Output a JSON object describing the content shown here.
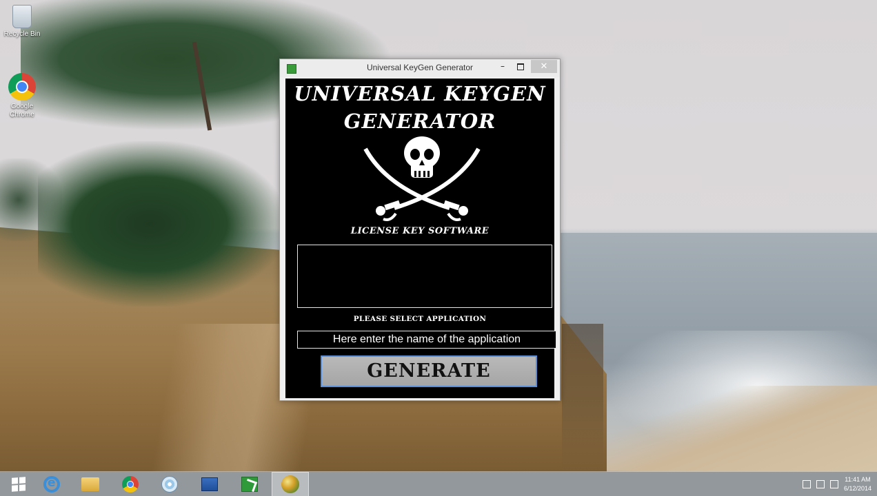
{
  "desktop": {
    "icons": [
      {
        "label": "Recycle Bin",
        "icon": "recycle-bin-icon"
      },
      {
        "label": "Google Chrome",
        "icon": "chrome-icon"
      }
    ]
  },
  "window": {
    "title": "Universal KeyGen Generator",
    "controls": {
      "minimize": "–",
      "close": "✕"
    },
    "heading_line1": "UNIVERSAL KEYGEN",
    "heading_line2": "GENERATOR",
    "logo_icon": "skull-crossed-swords-icon",
    "logo_caption": "LICENSE KEY SOFTWARE",
    "output_text": "",
    "select_label": "PLEASE SELECT APPLICATION",
    "app_input": {
      "value": "",
      "placeholder": "Here enter the name of the application"
    },
    "generate_label": "GENERATE",
    "accent_color": "#5a8ed6"
  },
  "taskbar": {
    "items": [
      {
        "name": "start-button",
        "icon": "windows-logo-icon"
      },
      {
        "name": "internet-explorer",
        "icon": "internet-explorer-icon"
      },
      {
        "name": "file-explorer",
        "icon": "folder-icon"
      },
      {
        "name": "google-chrome",
        "icon": "chrome-icon"
      },
      {
        "name": "media-disc",
        "icon": "disc-icon"
      },
      {
        "name": "network-app",
        "icon": "network-icon"
      },
      {
        "name": "keygen-app",
        "icon": "keygen-icon"
      },
      {
        "name": "active-app",
        "icon": "orb-icon"
      }
    ],
    "clock_time": "11:41 AM",
    "clock_date": "6/12/2014"
  }
}
